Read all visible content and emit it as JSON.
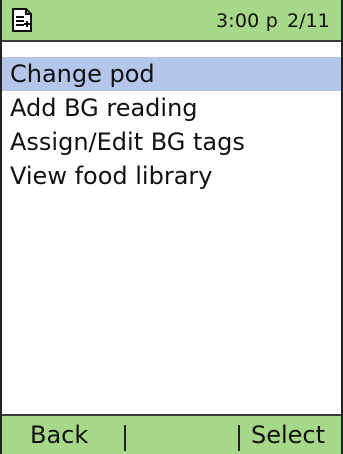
{
  "status_bar": {
    "icon": "notes-plus-icon",
    "time": "3:00 p",
    "date": "2/11"
  },
  "menu": {
    "items": [
      {
        "label": "Change pod",
        "selected": true
      },
      {
        "label": "Add BG reading",
        "selected": false
      },
      {
        "label": "Assign/Edit BG tags",
        "selected": false
      },
      {
        "label": "View food library",
        "selected": false
      }
    ]
  },
  "softkeys": {
    "left": "Back",
    "right": "Select"
  },
  "colors": {
    "bar_green": "#a6d889",
    "selection_blue": "#b4c7ea"
  }
}
